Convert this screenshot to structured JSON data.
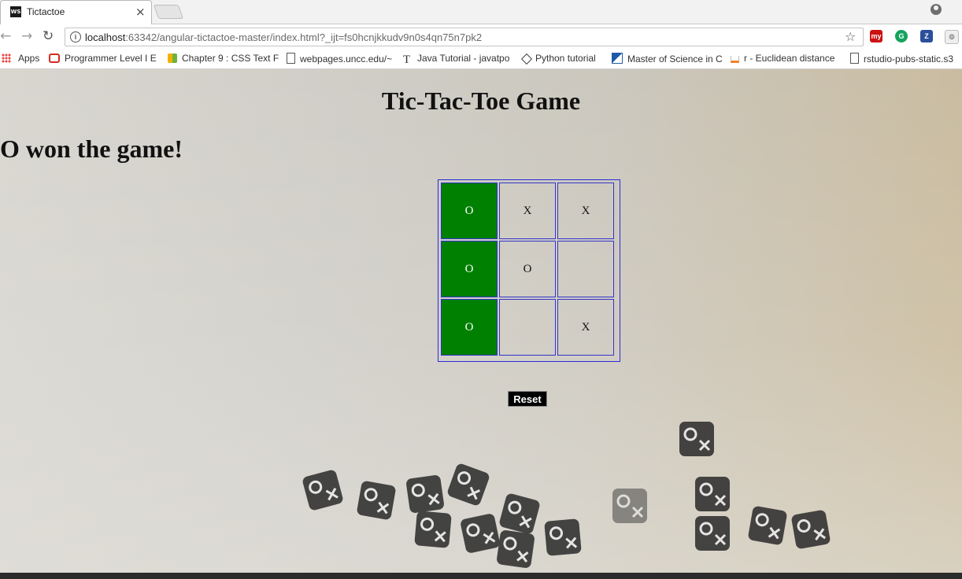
{
  "browser": {
    "tab_title": "Tictactoe",
    "tab_favicon_text": "WS",
    "close_glyph": "×",
    "url_host": "localhost",
    "url_rest": ":63342/angular-tictactoe-master/index.html?_ijt=fs0hcnjkkudv9n0s4qn75n7pk2",
    "extensions": [
      {
        "name": "my-extension-icon",
        "text": "my",
        "color": "#cc1111"
      },
      {
        "name": "grammarly-icon",
        "text": "G",
        "color": "#15a35f"
      },
      {
        "name": "zotero-icon",
        "text": "Z",
        "color": "#2b4f9a"
      }
    ]
  },
  "bookmarks": [
    {
      "label": "Apps",
      "icon": "apps-icon"
    },
    {
      "label": "Programmer Level I E",
      "icon": "oracle-icon"
    },
    {
      "label": "Chapter 9 : CSS Text F",
      "icon": "book-icon"
    },
    {
      "label": "webpages.uncc.edu/~",
      "icon": "page-icon"
    },
    {
      "label": "Java Tutorial - javatpo",
      "icon": "t-icon"
    },
    {
      "label": "Python tutorial",
      "icon": "diamond-icon"
    },
    {
      "label": "Master of Science in C",
      "icon": "flag-icon"
    },
    {
      "label": "r - Euclidean distance",
      "icon": "stack-icon"
    },
    {
      "label": "rstudio-pubs-static.s3",
      "icon": "page-icon"
    }
  ],
  "game": {
    "title": "Tic-Tac-Toe Game",
    "status": "O won the game!",
    "board": [
      [
        "O",
        "X",
        "X"
      ],
      [
        "O",
        "O",
        ""
      ],
      [
        "O",
        "",
        "X"
      ]
    ],
    "winning_cells": [
      [
        0,
        0
      ],
      [
        1,
        0
      ],
      [
        2,
        0
      ]
    ],
    "win_color": "#008000",
    "reset_label": "Reset"
  }
}
